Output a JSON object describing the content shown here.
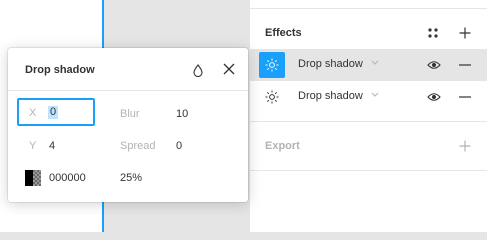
{
  "effects": {
    "title": "Effects",
    "style_icon": "styles-grid-icon",
    "add_icon": "plus-icon",
    "items": [
      {
        "label": "Drop shadow",
        "icon": "sun-icon",
        "selected": true
      },
      {
        "label": "Drop shadow",
        "icon": "sun-icon",
        "selected": false
      }
    ]
  },
  "export": {
    "title": "Export"
  },
  "popover": {
    "title": "Drop shadow",
    "fields": {
      "x_label": "X",
      "x_value": "0",
      "y_label": "Y",
      "y_value": "4",
      "blur_label": "Blur",
      "blur_value": "10",
      "spread_label": "Spread",
      "spread_value": "0",
      "color_hex": "000000",
      "opacity": "25%"
    }
  },
  "colors": {
    "accent": "#18a0fb",
    "selection": "#bde3ff",
    "row_selected": "#e5e5e5"
  }
}
